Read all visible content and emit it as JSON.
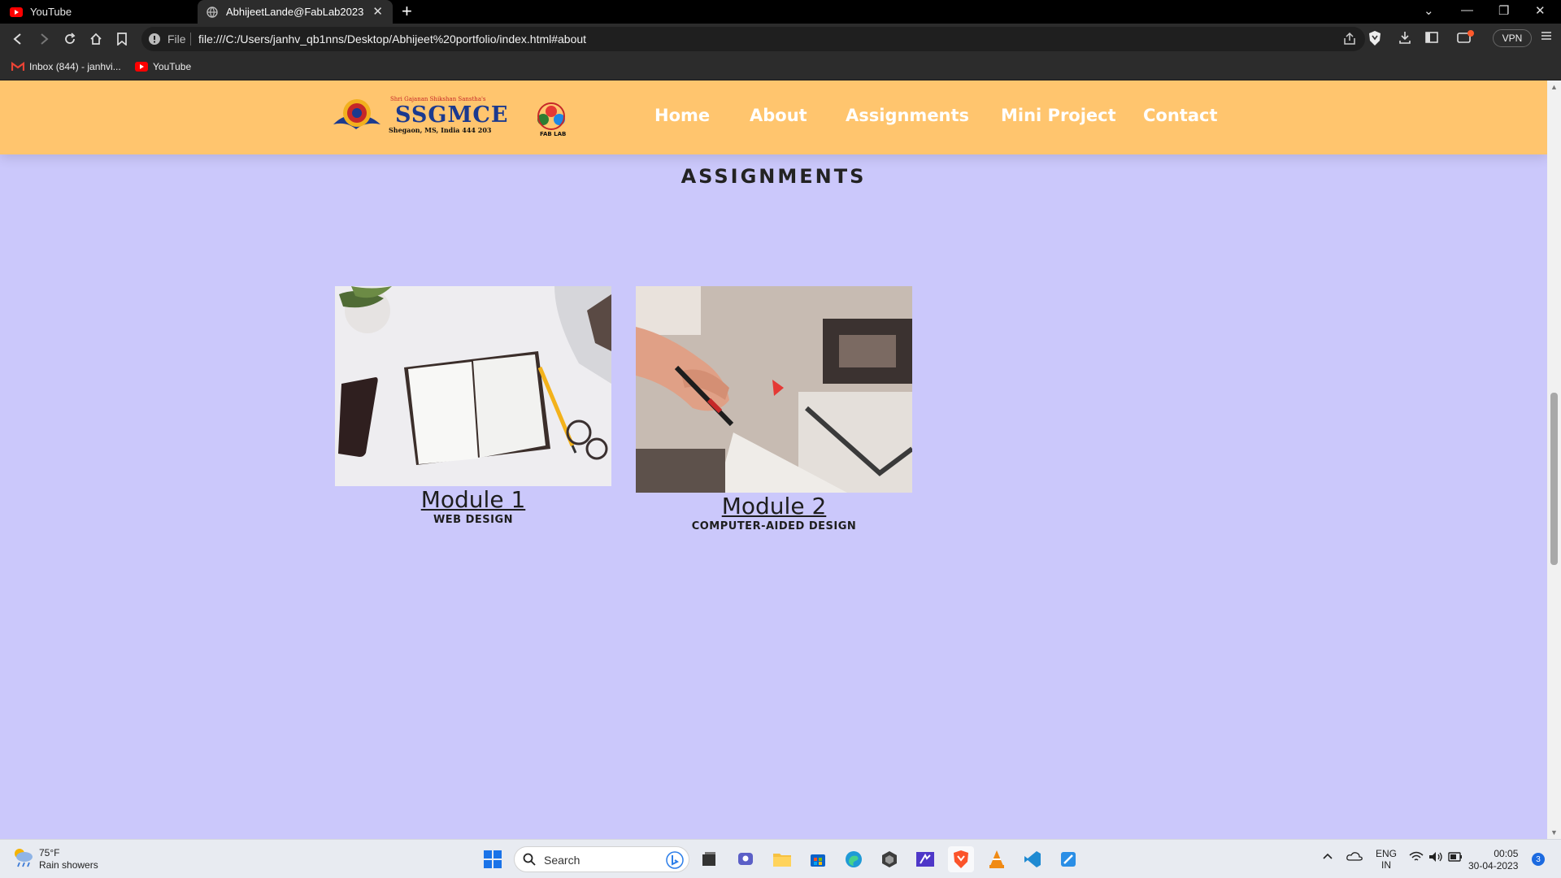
{
  "browser": {
    "tabs": [
      {
        "title": "YouTube",
        "icon": "youtube-icon",
        "active": false
      },
      {
        "title": "AbhijeetLande@FabLab2023",
        "icon": "globe-icon",
        "active": true
      }
    ],
    "address": {
      "scheme_label": "File",
      "url": "file:///C:/Users/janhv_qb1nns/Desktop/Abhijeet%20portfolio/index.html#about"
    },
    "vpn_label": "VPN",
    "bookmarks": [
      {
        "label": "Inbox (844) - janhvi...",
        "icon": "gmail-icon"
      },
      {
        "label": "YouTube",
        "icon": "youtube-icon"
      }
    ]
  },
  "site": {
    "logo": {
      "org_line": "Shri Gajanan Shikshan Sanstha's",
      "name": "SSGMCE",
      "location": "Shegaon, MS, India 444 203",
      "fablab": "FAB LAB"
    },
    "nav": [
      "Home",
      "About",
      "Assignments",
      "Mini Project",
      "Contact"
    ],
    "section_title": "ASSIGNMENTS",
    "modules": [
      {
        "title": "Module 1",
        "subtitle": "WEB DESIGN",
        "image": "notebook-desk-photo"
      },
      {
        "title": "Module 2",
        "subtitle": "COMPUTER-AIDED DESIGN",
        "image": "hand-drawing-photo"
      }
    ]
  },
  "taskbar": {
    "weather": {
      "temp": "75°F",
      "condition": "Rain showers"
    },
    "search_label": "Search",
    "apps": [
      "start-icon",
      "task-view-icon",
      "teams-icon",
      "file-explorer-icon",
      "store-icon",
      "edge-icon",
      "app-icon",
      "vs-icon",
      "brave-icon",
      "vlc-icon",
      "vscode-icon",
      "editor-icon"
    ],
    "language": {
      "line1": "ENG",
      "line2": "IN"
    },
    "time": "00:05",
    "date": "30-04-2023",
    "notifications": "3"
  },
  "colors": {
    "page_bg": "#cbc8fb",
    "navbar_bg": "#ffc56e",
    "nav_text": "#ffffff"
  }
}
